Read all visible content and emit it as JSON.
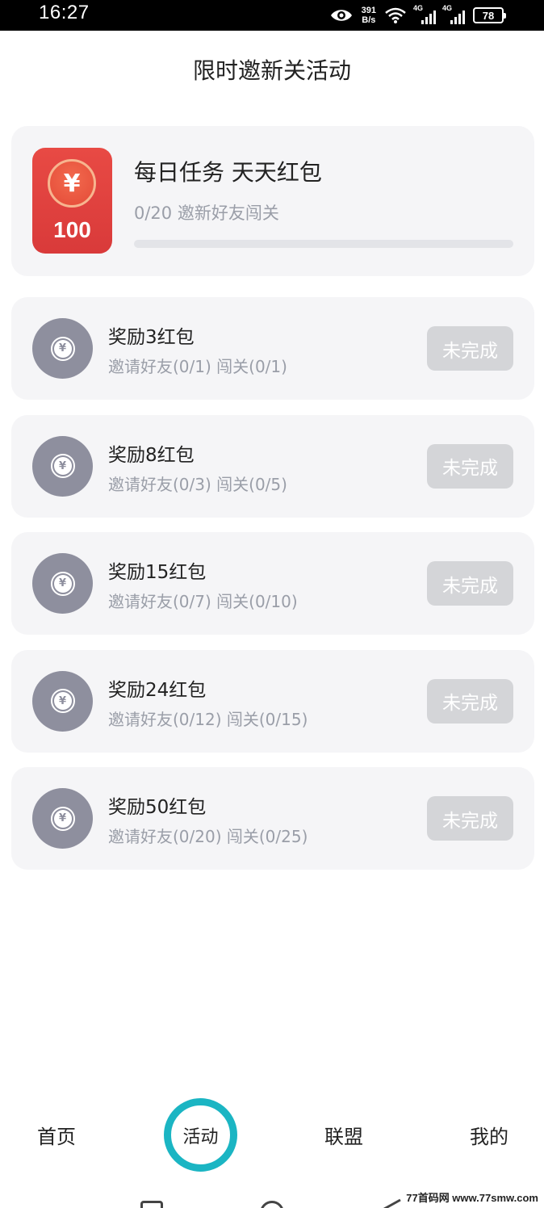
{
  "status_bar": {
    "time": "16:27",
    "net_speed_value": "391",
    "net_speed_unit": "B/s",
    "signal1_tag": "4G",
    "signal2_tag": "4G",
    "battery": "78",
    "icons": [
      "eye-icon",
      "wifi-icon",
      "signal-icon",
      "signal-icon",
      "battery-icon"
    ]
  },
  "page": {
    "title": "限时邀新关活动"
  },
  "daily_task": {
    "amount": "100",
    "currency_symbol": "¥",
    "title": "每日任务 天天红包",
    "progress_text": "0/20 邀新好友闯关",
    "progress_fraction": 0,
    "accent_color": "#e84a44"
  },
  "rewards": [
    {
      "title": "奖励3红包",
      "condition": "邀请好友(0/1) 闯关(0/1)",
      "status": "未完成",
      "coin_symbol": "¥"
    },
    {
      "title": "奖励8红包",
      "condition": "邀请好友(0/3) 闯关(0/5)",
      "status": "未完成",
      "coin_symbol": "¥"
    },
    {
      "title": "奖励15红包",
      "condition": "邀请好友(0/7) 闯关(0/10)",
      "status": "未完成",
      "coin_symbol": "¥"
    },
    {
      "title": "奖励24红包",
      "condition": "邀请好友(0/12) 闯关(0/15)",
      "status": "未完成",
      "coin_symbol": "¥"
    },
    {
      "title": "奖励50红包",
      "condition": "邀请好友(0/20) 闯关(0/25)",
      "status": "未完成",
      "coin_symbol": "¥"
    }
  ],
  "bottom_nav": {
    "home": "首页",
    "activity": "活动",
    "alliance": "联盟",
    "mine": "我的",
    "active_color": "#1bb5c3"
  },
  "watermark": "77首码网 www.77smw.com"
}
